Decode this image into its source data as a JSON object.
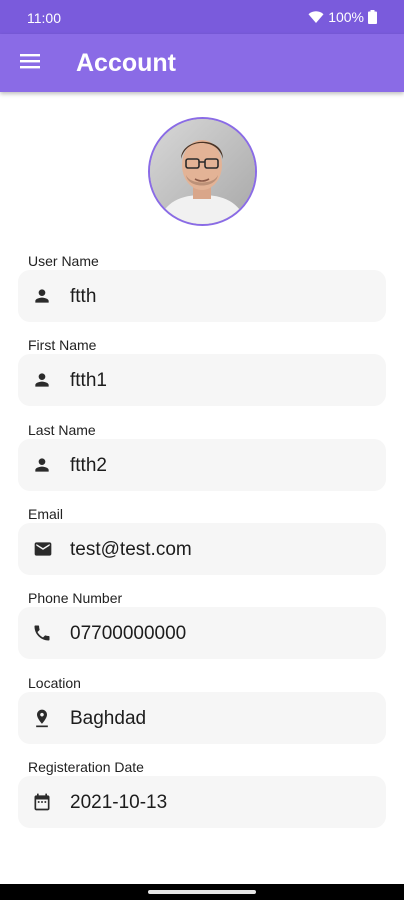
{
  "status_bar": {
    "time": "11:00",
    "battery": "100%",
    "icons": [
      "wifi-icon",
      "battery-icon"
    ]
  },
  "app_bar": {
    "title": "Account",
    "menu_icon": "menu-icon",
    "color": "#8a6be6"
  },
  "profile": {
    "avatar": "user-photo"
  },
  "fields": [
    {
      "label": "User Name",
      "value": "ftth",
      "icon": "person-icon"
    },
    {
      "label": "First Name",
      "value": "ftth1",
      "icon": "person-icon"
    },
    {
      "label": "Last Name",
      "value": "ftth2",
      "icon": "person-icon"
    },
    {
      "label": "Email",
      "value": "test@test.com",
      "icon": "email-icon"
    },
    {
      "label": "Phone Number",
      "value": "07700000000",
      "icon": "phone-icon"
    },
    {
      "label": "Location",
      "value": "Baghdad",
      "icon": "location-pin-icon"
    },
    {
      "label": "Registeration Date",
      "value": "2021-10-13",
      "icon": "calendar-icon"
    }
  ],
  "colors": {
    "accent": "#8a6be6",
    "status_bar": "#7a5bdc",
    "field_background": "#f6f6f6"
  }
}
